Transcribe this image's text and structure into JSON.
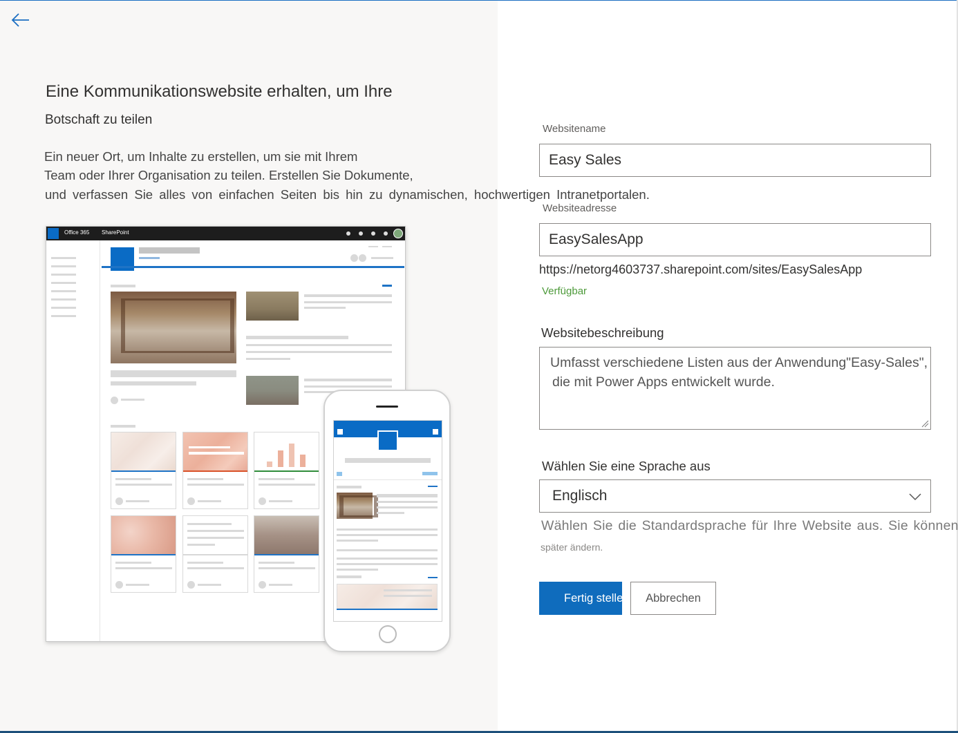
{
  "hero": {
    "title": "Eine Kommunikationswebsite erhalten, um Ihre",
    "subtitle": "Botschaft zu teilen",
    "description_lines": [
      "Ein neuer Ort, um Inhalte zu erstellen, um sie mit Ihrem",
      "Team oder Ihrer Organisation zu teilen. Erstellen Sie Dokumente,",
      "und verfassen Sie alles von einfachen Seiten bis hin zu dynamischen, hochwertigen Intranetportalen."
    ]
  },
  "preview": {
    "suite_name": "Office 365",
    "app_name": "SharePoint"
  },
  "form": {
    "site_name": {
      "label": "Websitename",
      "value": "Easy Sales"
    },
    "site_address": {
      "label": "Websiteadresse",
      "value": "EasySalesApp",
      "url": "https://netorg4603737.sharepoint.com/sites/EasySalesApp",
      "availability": "Verfügbar"
    },
    "site_description": {
      "label": "Websitebeschreibung",
      "lines": [
        "Umfasst verschiedene Listen aus der Anwendung\"Easy-Sales\",",
        "die mit Power Apps entwickelt wurde."
      ]
    },
    "language": {
      "label": "Wählen Sie eine Sprache aus",
      "selected": "Englisch",
      "help_line1": "Wählen Sie die Standardsprache für Ihre Website aus. Sie können d",
      "help_line2": "später ändern."
    },
    "buttons": {
      "finish": "Fertig stellen",
      "cancel": "Abbrechen"
    }
  },
  "colors": {
    "accent": "#0f6cbd",
    "available": "#4d9a3a",
    "panel": "#f8f7f6"
  },
  "icons": {
    "back": "back-arrow-icon",
    "dropdown": "chevron-down-icon"
  }
}
